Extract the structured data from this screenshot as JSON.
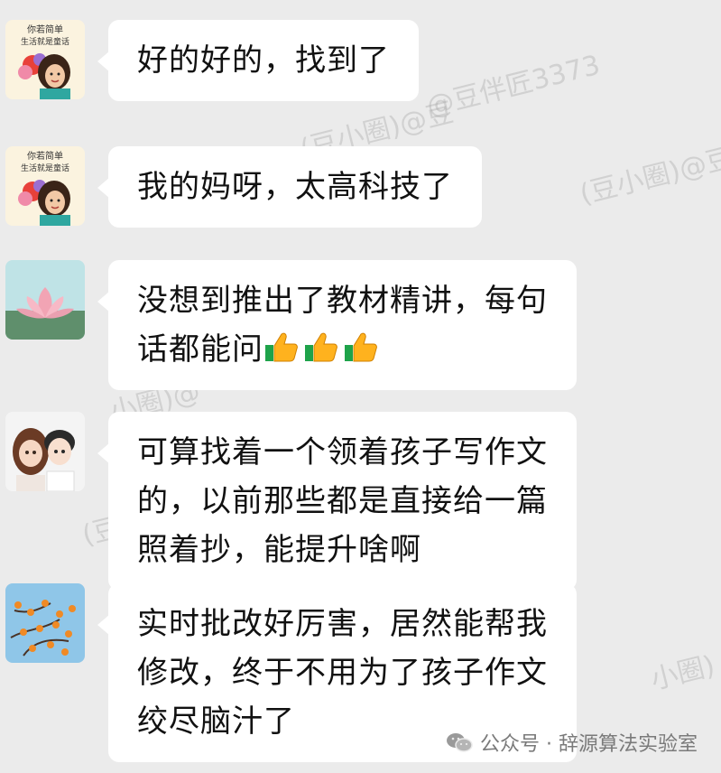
{
  "watermarks": [
    "@豆伴匠3373",
    "(豆小圈)@豆",
    "(豆小圈)@豆",
    "小圈)@",
    "(豆小",
    "小圈)"
  ],
  "messages": [
    {
      "avatar": "avatar-girl-reading",
      "avatar_text": [
        "你若简单",
        "生活就是童话"
      ],
      "lines": [
        "好的好的，找到了"
      ]
    },
    {
      "avatar": "avatar-girl-reading",
      "avatar_text": [
        "你若简单",
        "生活就是童话"
      ],
      "lines": [
        "我的妈呀，太高科技了"
      ]
    },
    {
      "avatar": "avatar-lotus",
      "lines": [
        "没想到推出了教材精讲，每句",
        "话都能问"
      ],
      "thumbs": 3
    },
    {
      "avatar": "avatar-couple",
      "lines": [
        "可算找着一个领着孩子写作文",
        "的，以前那些都是直接给一篇",
        "照着抄，能提升啥啊"
      ]
    },
    {
      "avatar": "avatar-persimmon-tree",
      "lines": [
        "实时批改好厉害，居然能帮我",
        "修改，终于不用为了孩子作文",
        "绞尽脑汁了"
      ]
    }
  ],
  "footer": {
    "icon": "wechat-icon",
    "text": "公众号 · 辞源算法实验室"
  },
  "colors": {
    "background": "#ebebeb",
    "bubble": "#ffffff",
    "text": "#111111",
    "footer_text": "#7a7a7a"
  }
}
